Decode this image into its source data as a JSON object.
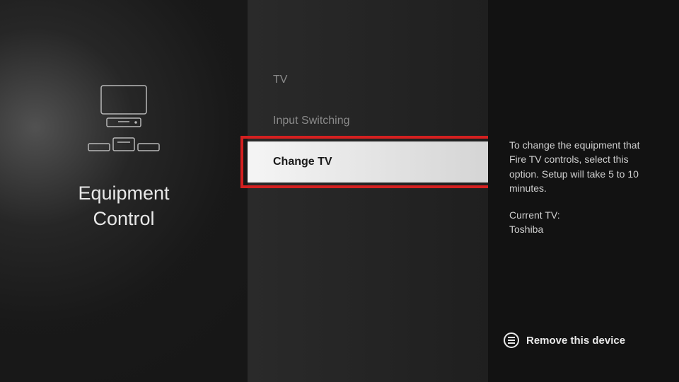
{
  "left": {
    "title_line1": "Equipment",
    "title_line2": "Control"
  },
  "menu": {
    "items": [
      {
        "label": "TV"
      },
      {
        "label": "Input Switching"
      },
      {
        "label": "Change TV",
        "selected": true
      }
    ]
  },
  "right": {
    "description": "To change the equipment that Fire TV controls, select this option. Setup will take 5 to 10 minutes.",
    "current_label": "Current TV:",
    "current_value": "Toshiba"
  },
  "footer": {
    "remove_label": "Remove this device"
  }
}
